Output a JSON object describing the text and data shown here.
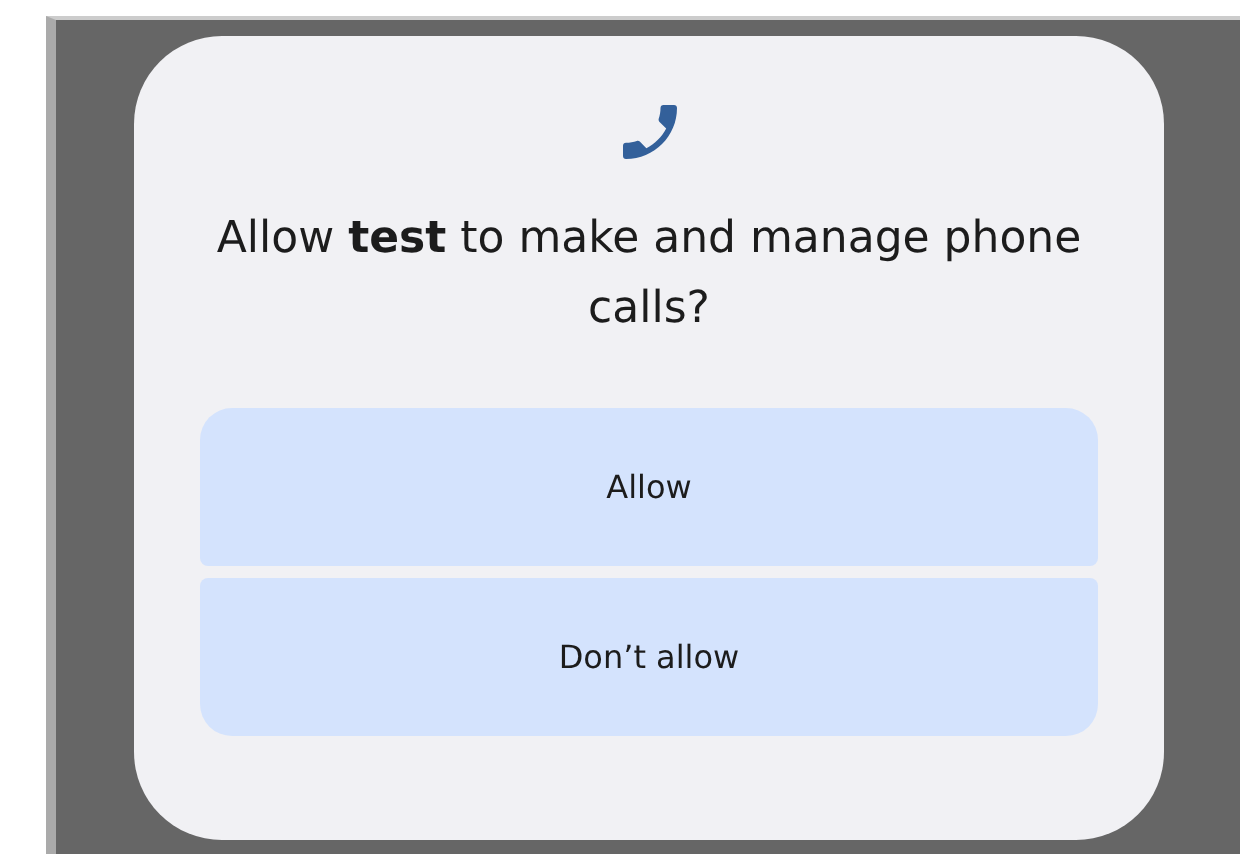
{
  "dialog": {
    "title": "Allow **test** to make and manage phone calls?",
    "buttons": [
      {
        "label": "Allow",
        "kind": "allow"
      },
      {
        "label": "Don’t allow",
        "kind": "deny"
      }
    ]
  }
}
